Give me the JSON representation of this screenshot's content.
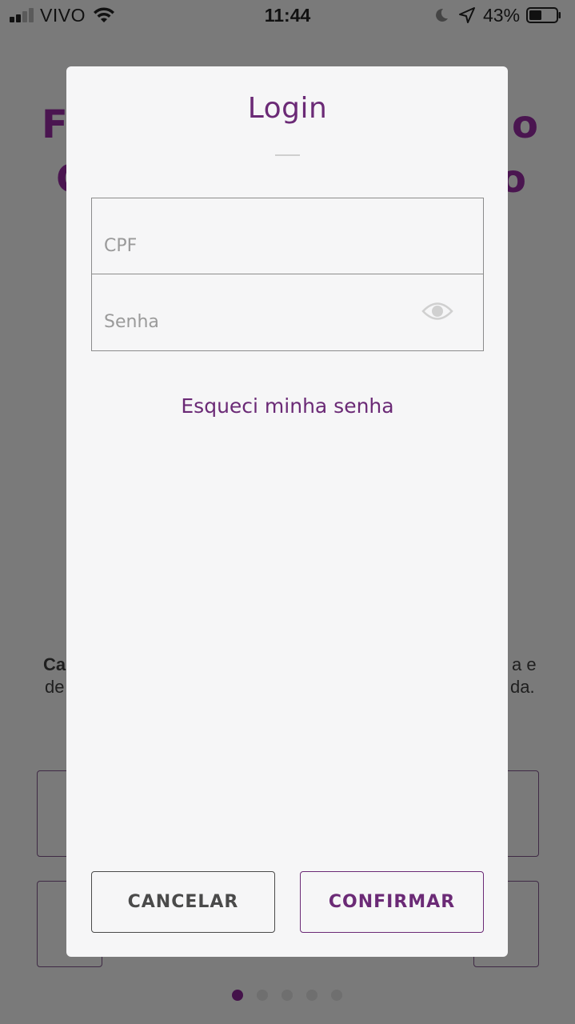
{
  "status_bar": {
    "carrier": "VIVO",
    "time": "11:44",
    "battery": "43%"
  },
  "background": {
    "headline_line1_start": "Fa",
    "headline_line1_end": "o",
    "headline_line2_start": "C",
    "headline_line2_end": "o",
    "body_line1_start": "Ca",
    "body_line1_end": "a e",
    "body_line2_start": "de",
    "body_line2_end": "da.",
    "pagination_count": 5,
    "pagination_active": 1
  },
  "modal": {
    "title": "Login",
    "cpf_placeholder": "CPF",
    "senha_placeholder": "Senha",
    "forgot_label": "Esqueci minha senha",
    "cancel_label": "CANCELAR",
    "confirm_label": "CONFIRMAR"
  },
  "colors": {
    "brand_purple": "#6b2a76",
    "dark_purple": "#44124a",
    "modal_bg": "#f6f6f7",
    "overlay_bg": "#7a7a7a"
  },
  "icons": {
    "signal": "cellular-signal-icon",
    "wifi": "wifi-icon",
    "moon": "do-not-disturb-moon-icon",
    "location": "location-arrow-icon",
    "battery": "battery-icon",
    "eye": "show-password-eye-icon"
  }
}
